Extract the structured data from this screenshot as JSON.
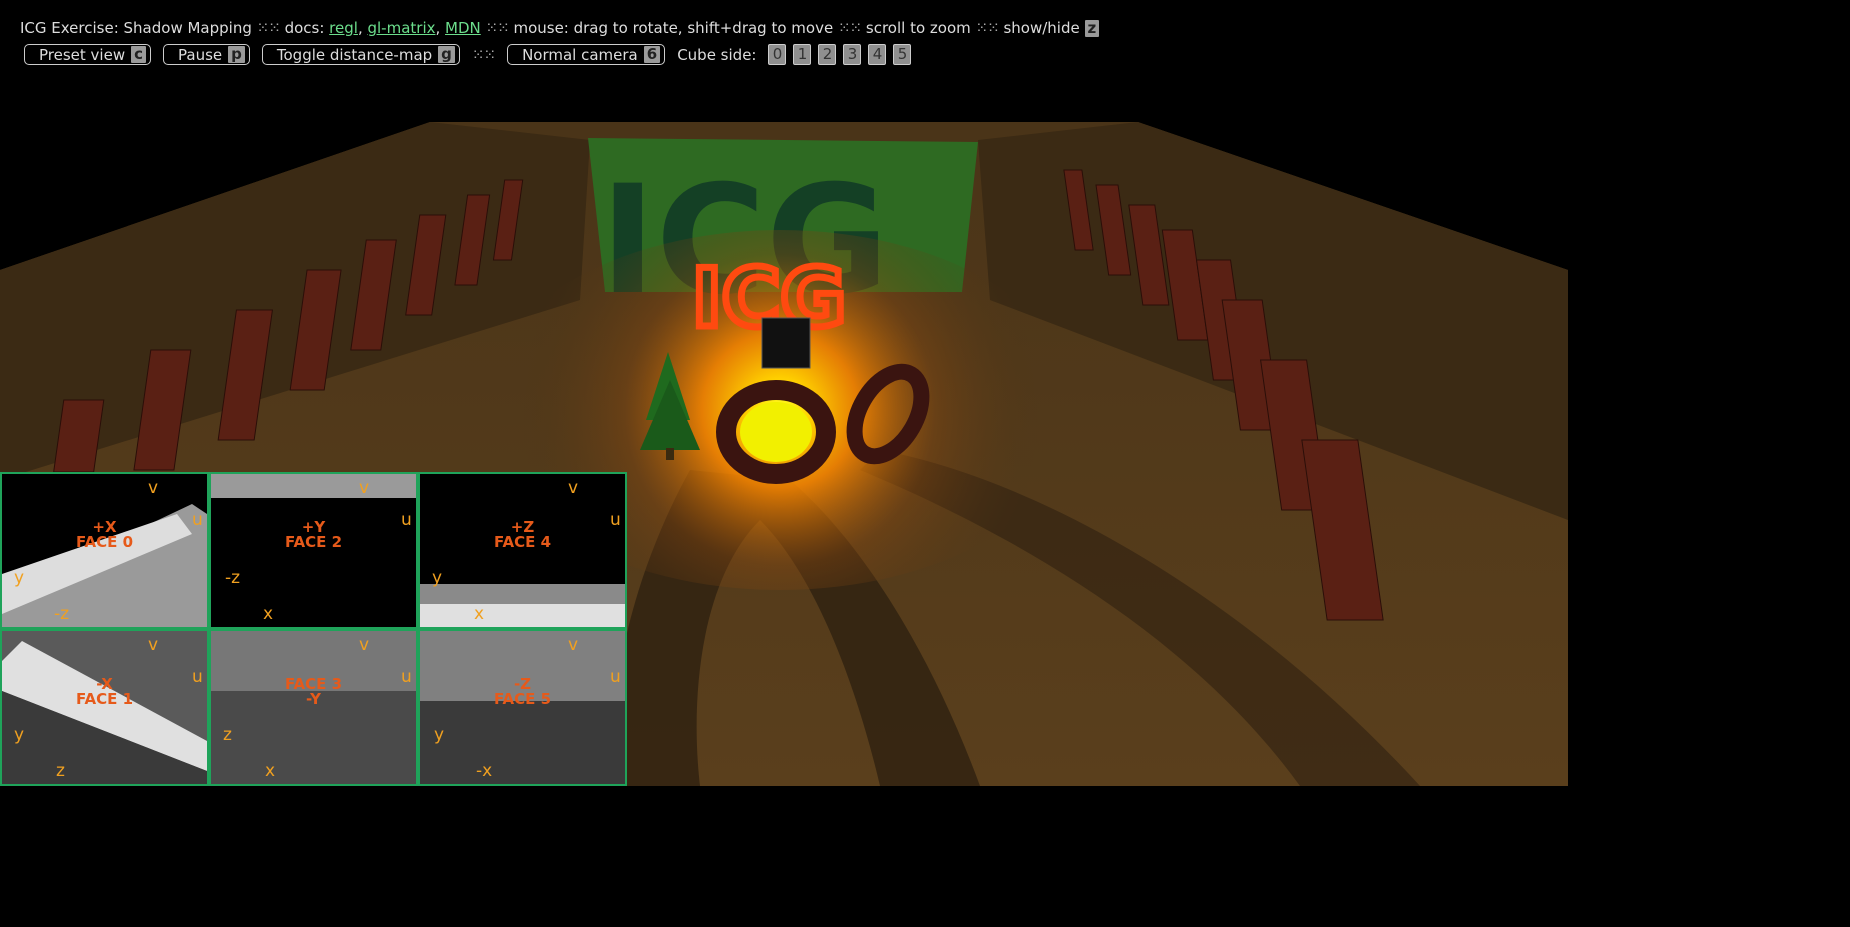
{
  "header": {
    "title": "ICG Exercise: Shadow Mapping",
    "sep": "⁙⁙",
    "docs_label": "docs:",
    "links": [
      "regl",
      "gl-matrix",
      "MDN"
    ],
    "mouse_help": "mouse: drag to rotate, shift+drag to move",
    "scroll_help": "scroll to zoom",
    "showhide_label": "show/hide",
    "showhide_key": "z"
  },
  "buttons": {
    "preset": {
      "label": "Preset view",
      "key": "c"
    },
    "pause": {
      "label": "Pause",
      "key": "p"
    },
    "toggle": {
      "label": "Toggle distance-map",
      "key": "g"
    },
    "camera": {
      "label": "Normal camera",
      "key": "6"
    }
  },
  "cube_side": {
    "label": "Cube side:",
    "options": [
      "0",
      "1",
      "2",
      "3",
      "4",
      "5"
    ]
  },
  "scene": {
    "backdrop_text": "ICG",
    "floating_text": "ICG"
  },
  "faces": [
    {
      "line1": "+X",
      "line2": "FACE 0",
      "u": "u",
      "v": "v",
      "ax_up": "y",
      "ax_right": "-z"
    },
    {
      "line1": "+Y",
      "line2": "FACE 2",
      "u": "u",
      "v": "v",
      "ax_up": "-z",
      "ax_right": "x"
    },
    {
      "line1": "+Z",
      "line2": "FACE 4",
      "u": "u",
      "v": "v",
      "ax_up": "y",
      "ax_right": "x"
    },
    {
      "line1": "-X",
      "line2": "FACE 1",
      "u": "u",
      "v": "v",
      "ax_up": "y",
      "ax_right": "z"
    },
    {
      "line1": "FACE 3",
      "line2": "-Y",
      "u": "u",
      "v": "v",
      "ax_up": "z",
      "ax_right": "x"
    },
    {
      "line1": "-Z",
      "line2": "FACE 5",
      "u": "u",
      "v": "v",
      "ax_up": "y",
      "ax_right": "-x"
    }
  ],
  "colors": {
    "accent_green": "#1fa35a",
    "face_label": "#e65a1a",
    "axis": "#f0a020"
  }
}
